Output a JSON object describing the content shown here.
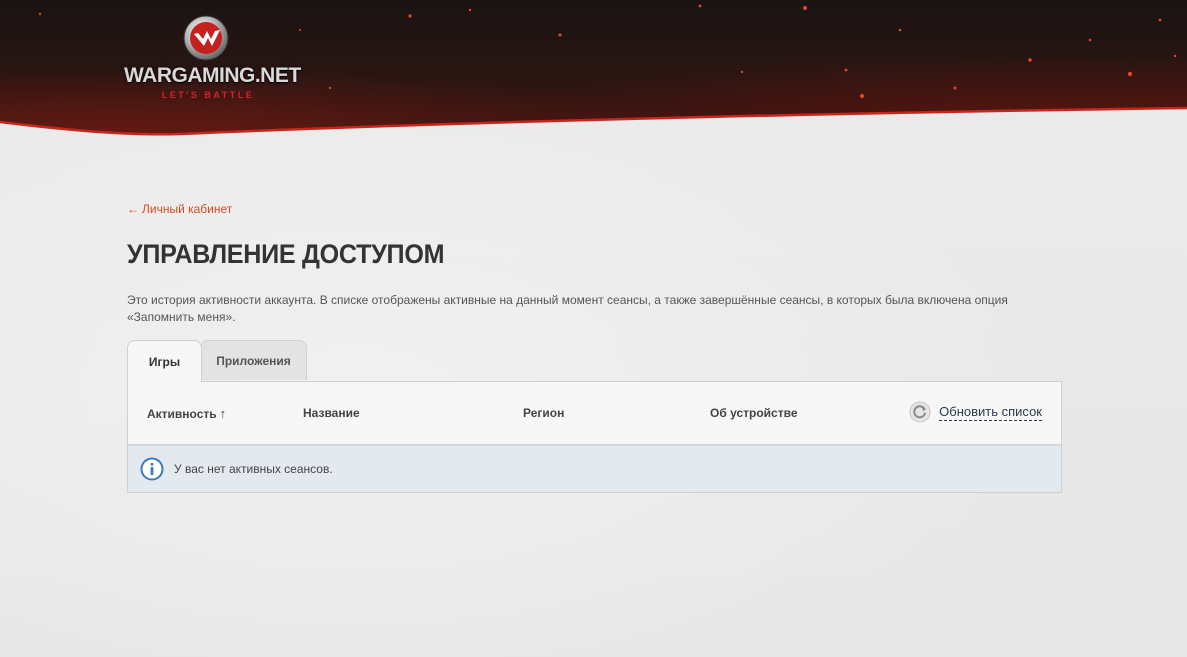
{
  "brand": {
    "name": "WARGAMING.NET",
    "tagline": "LET'S BATTLE",
    "accent": "#d84a1b",
    "logo_red": "#d0262b"
  },
  "nav": {
    "back_arrow": "←",
    "back_label": "Личный кабинет"
  },
  "page": {
    "title": "УПРАВЛЕНИЕ ДОСТУПОМ",
    "description": "Это история активности аккаунта. В списке отображены активные на данный момент сеансы, а также завершённые сеансы, в которых была включена опция «Запомнить меня»."
  },
  "tabs": [
    {
      "label": "Игры",
      "active": true
    },
    {
      "label": "Приложения",
      "active": false
    }
  ],
  "table": {
    "columns": {
      "activity": "Активность",
      "activity_sort": "↑",
      "name": "Название",
      "region": "Регион",
      "device": "Об устройстве"
    },
    "refresh_label": "Обновить список",
    "refresh_icon": "refresh-icon"
  },
  "notice": {
    "icon": "info-icon",
    "text": "У вас нет активных сеансов."
  }
}
